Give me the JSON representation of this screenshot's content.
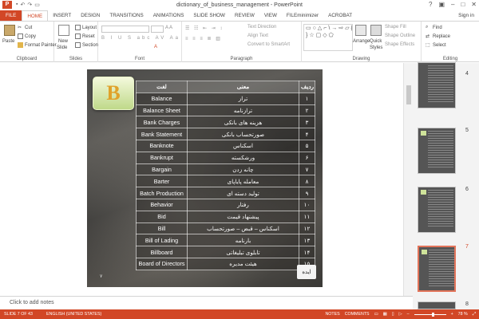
{
  "window": {
    "title": "dictionary_of_business_management - PowerPoint",
    "signin": "Sign in"
  },
  "tabs": [
    "FILE",
    "HOME",
    "INSERT",
    "DESIGN",
    "TRANSITIONS",
    "ANIMATIONS",
    "SLIDE SHOW",
    "REVIEW",
    "VIEW",
    "FILEminimizer",
    "ACROBAT"
  ],
  "ribbon": {
    "clipboard": {
      "paste": "Paste",
      "cut": "Cut",
      "copy": "Copy",
      "format_painter": "Format Painter",
      "label": "Clipboard"
    },
    "slides": {
      "new_slide": "New",
      "new_slide2": "Slide",
      "layout": "Layout",
      "reset": "Reset",
      "section": "Section",
      "label": "Slides"
    },
    "font": {
      "label": "Font"
    },
    "paragraph": {
      "text_direction": "Text Direction",
      "align_text": "Align Text",
      "smartart": "Convert to SmartArt",
      "label": "Paragraph"
    },
    "drawing": {
      "arrange": "Arrange",
      "quick": "Quick",
      "styles": "Styles",
      "shape_fill": "Shape Fill",
      "shape_outline": "Shape Outline",
      "shape_effects": "Shape Effects",
      "label": "Drawing"
    },
    "editing": {
      "find": "Find",
      "replace": "Replace",
      "select": "Select",
      "label": "Editing"
    }
  },
  "slide": {
    "letter": "B",
    "headers": {
      "word": "لغت",
      "meaning": "معنی",
      "row": "ردیف"
    },
    "rows": [
      {
        "word": "Balance",
        "meaning": "تراز",
        "n": "۱"
      },
      {
        "word": "Balance Sheet",
        "meaning": "ترازنامه",
        "n": "۲"
      },
      {
        "word": "Bank Charges",
        "meaning": "هزینه های بانکی",
        "n": "۳"
      },
      {
        "word": "Bank Statement",
        "meaning": "صورتحساب بانکی",
        "n": "۴"
      },
      {
        "word": "Banknote",
        "meaning": "اسکناس",
        "n": "۵"
      },
      {
        "word": "Bankrupt",
        "meaning": "ورشکسته",
        "n": "۶"
      },
      {
        "word": "Bargain",
        "meaning": "چانه زدن",
        "n": "۷"
      },
      {
        "word": "Barter",
        "meaning": "معامله پایاپای",
        "n": "۸"
      },
      {
        "word": "Batch Production",
        "meaning": "تولید دسته ای",
        "n": "۹"
      },
      {
        "word": "Behavior",
        "meaning": "رفتار",
        "n": "۱۰"
      },
      {
        "word": "Bid",
        "meaning": "پیشنهاد قیمت",
        "n": "۱۱"
      },
      {
        "word": "Bill",
        "meaning": "اسکناس – قبض – صورتحساب",
        "n": "۱۲"
      },
      {
        "word": "Bill of Lading",
        "meaning": "بارنامه",
        "n": "۱۳"
      },
      {
        "word": "Billboard",
        "meaning": "تابلوی تبلیغاتی",
        "n": "۱۴"
      },
      {
        "word": "Board of Directors",
        "meaning": "هیئت مدیره",
        "n": "۱۵"
      }
    ],
    "page": "۷",
    "stamp": "ایده"
  },
  "thumbnails": [
    "4",
    "5",
    "6",
    "7",
    "8"
  ],
  "notes": "Click to add notes",
  "status": {
    "slide": "SLIDE 7 OF 43",
    "language": "ENGLISH (UNITED STATES)",
    "notes": "NOTES",
    "comments": "COMMENTS",
    "zoom": "78 %"
  },
  "accent": "#d24726"
}
